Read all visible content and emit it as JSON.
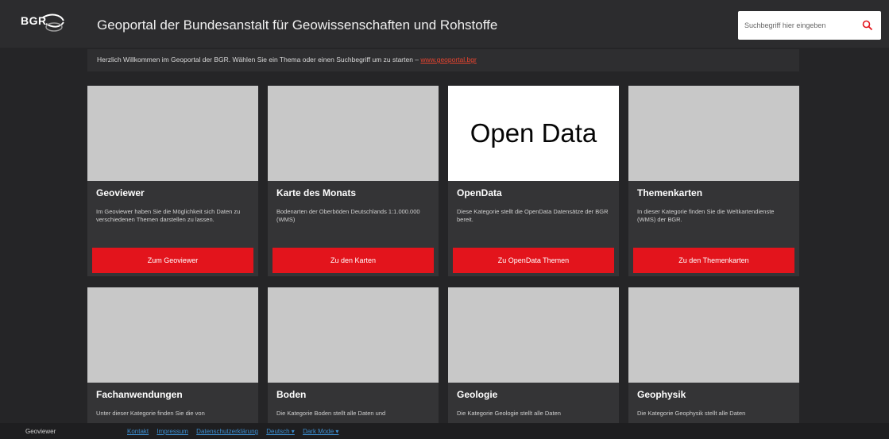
{
  "header": {
    "logo_text": "BGR",
    "title": "Geoportal der Bundesanstalt für Geowissenschaften und Rohstoffe",
    "search_placeholder": "Suchbegriff hier eingeben",
    "search_icon": "search-icon"
  },
  "welcome": {
    "text": "Herzlich Willkommen im Geoportal der BGR. Wählen Sie ein Thema oder einen Suchbegriff um zu starten –",
    "link": "www.geoportal.bgr"
  },
  "cards": [
    {
      "title": "Geoviewer",
      "desc": "Im Geoviewer haben Sie die Möglichkeit sich Daten zu verschiedenen Themen darstellen zu lassen.",
      "button": "Zum Geoviewer"
    },
    {
      "title": "Karte des Monats",
      "desc": "Bodenarten der Oberböden Deutschlands 1:1.000.000 (WMS)",
      "button": "Zu den Karten"
    },
    {
      "title": "OpenData",
      "desc": "Diese Kategorie stellt die OpenData Datensätze der BGR bereit.",
      "button": "Zu OpenData Themen",
      "image_text": "Open Data"
    },
    {
      "title": "Themenkarten",
      "desc": "In dieser Kategorie finden Sie die Weltkartendienste (WMS) der BGR.",
      "button": "Zu den Themenkarten"
    },
    {
      "title": "Fachanwendungen",
      "desc": "Unter dieser Kategorie finden Sie die von"
    },
    {
      "title": "Boden",
      "desc": "Die Kategorie Boden stellt alle Daten und"
    },
    {
      "title": "Geologie",
      "desc": "Die Kategorie Geologie stellt alle Daten"
    },
    {
      "title": "Geophysik",
      "desc": "Die Kategorie Geophysik stellt alle Daten"
    }
  ],
  "footer": {
    "label": "Geoviewer",
    "links": [
      "Kontakt",
      "Impressum",
      "Datenschutzerklärung",
      "Deutsch ▾",
      "Dark Mode ▾"
    ]
  }
}
